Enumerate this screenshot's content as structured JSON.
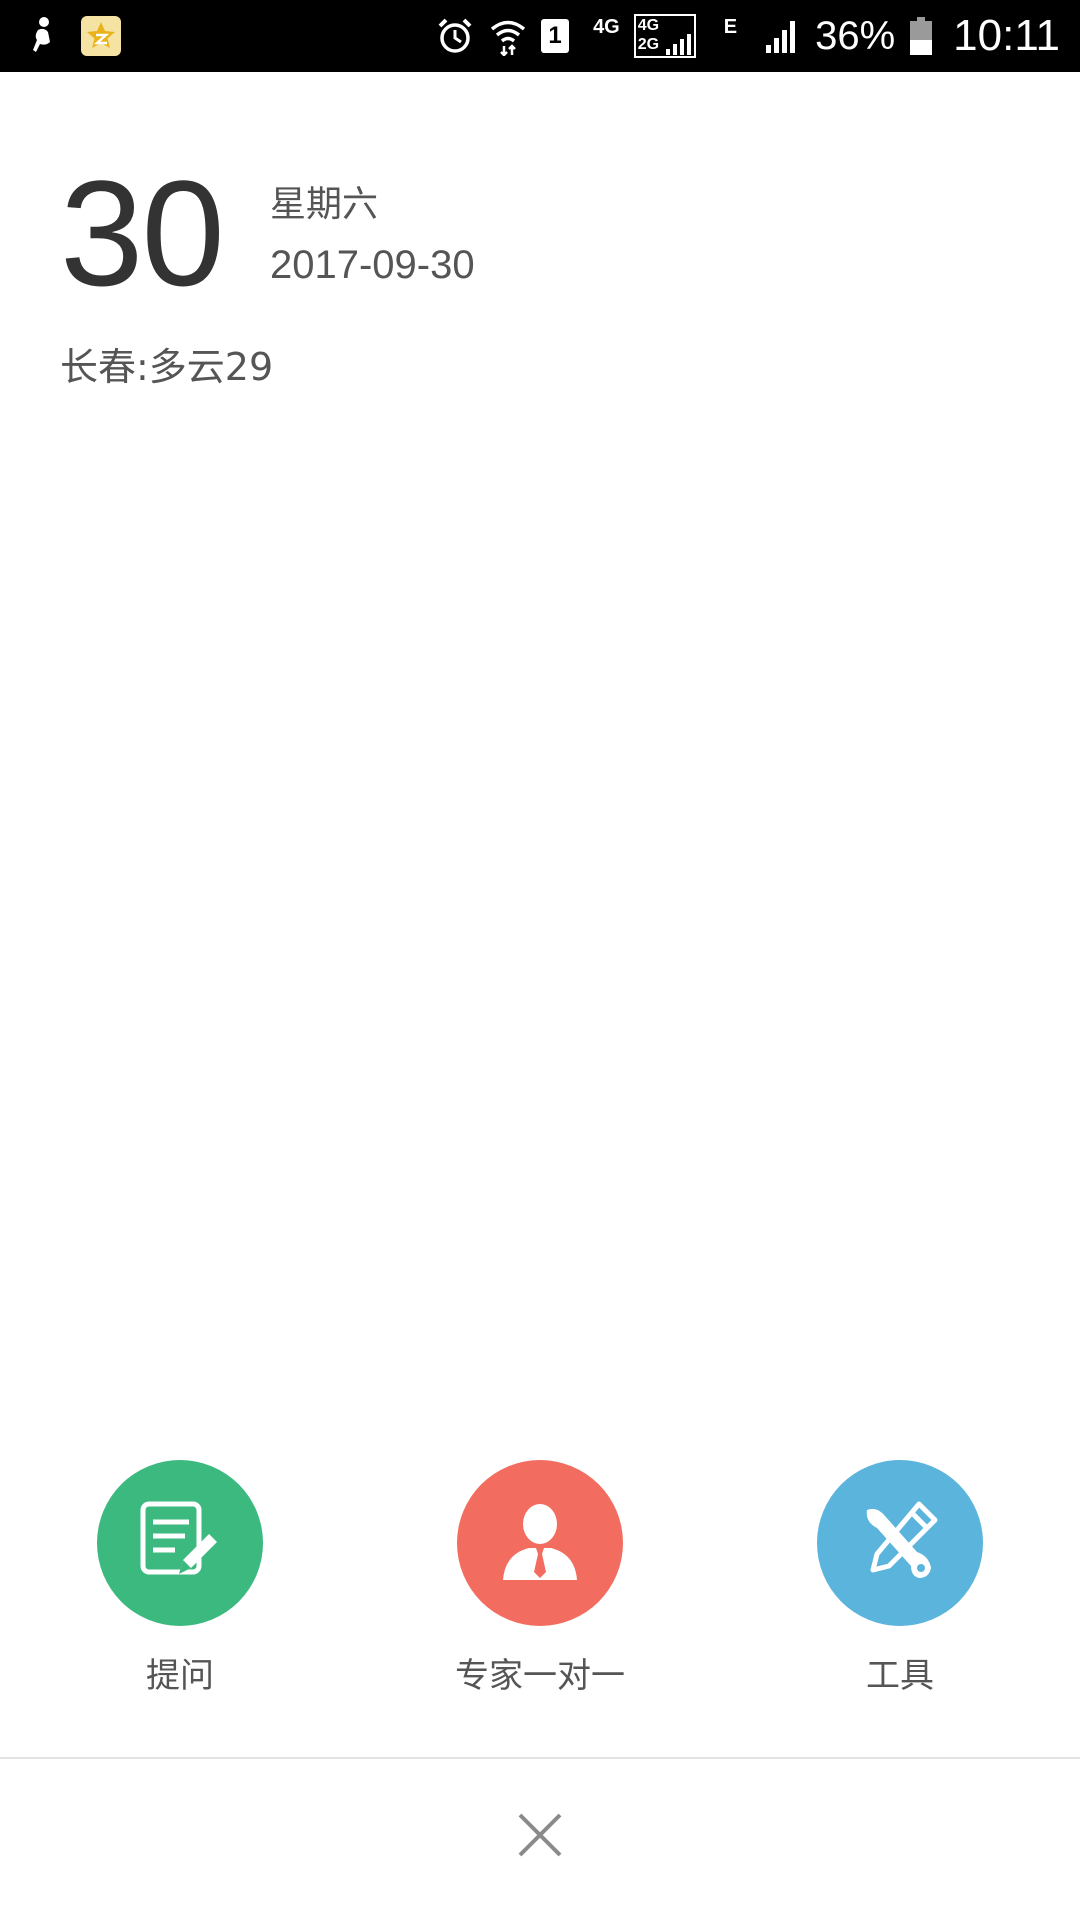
{
  "status_bar": {
    "sim_slot": "1",
    "network_4g": "4G",
    "network_box_top": "4G",
    "network_box_bottom": "2G",
    "network_e": "E",
    "battery_percent": "36%",
    "time": "10:11"
  },
  "date": {
    "day": "30",
    "weekday": "星期六",
    "full_date": "2017-09-30"
  },
  "weather": {
    "text": "长春:多云29"
  },
  "actions": [
    {
      "label": "提问",
      "icon": "edit-note-icon",
      "color": "#3CB97F"
    },
    {
      "label": "专家一对一",
      "icon": "expert-person-icon",
      "color": "#F26D5F"
    },
    {
      "label": "工具",
      "icon": "tools-icon",
      "color": "#5AB4DC"
    }
  ],
  "close": {
    "icon": "close-icon",
    "color": "#8A8A8A"
  }
}
